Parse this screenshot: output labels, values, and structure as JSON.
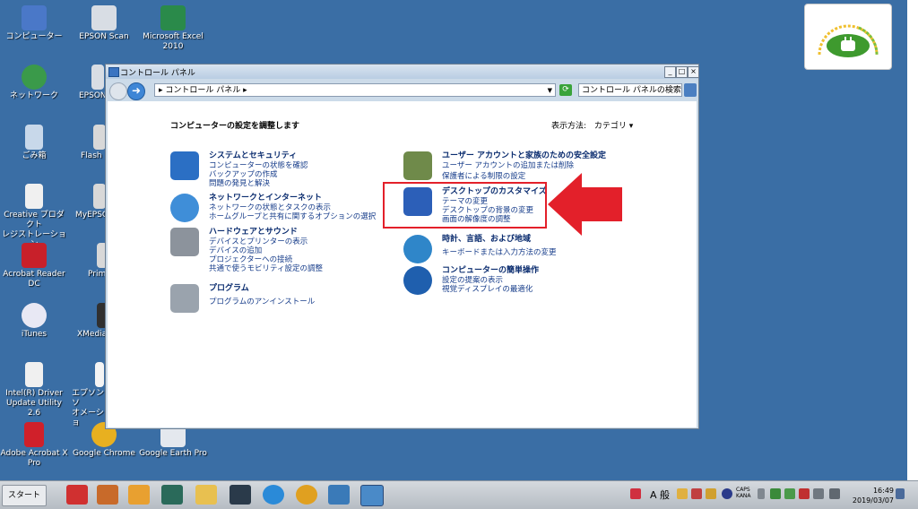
{
  "desktop_icons": [
    {
      "label": "コンピューター",
      "icon": "computer-icon",
      "color": "#4a78c8"
    },
    {
      "label": "ネットワーク",
      "icon": "network-icon",
      "color": "#3a9a4a"
    },
    {
      "label": "ごみ箱",
      "icon": "recycle-bin-icon",
      "color": "#c8d8ea"
    },
    {
      "label": "Creative プロダクト\nレジストレーション",
      "icon": "creative-icon",
      "color": "#f0f0f0"
    },
    {
      "label": "Acrobat Reader DC",
      "icon": "acrobat-reader-icon",
      "color": "#c8202a"
    },
    {
      "label": "iTunes",
      "icon": "itunes-icon",
      "color": "#e8e8f4"
    },
    {
      "label": "Intel(R) Driver\nUpdate Utility 2.6",
      "icon": "intel-icon",
      "color": "#f0f0f0"
    },
    {
      "label": "Adobe Acrobat X\nPro",
      "icon": "adobe-acrobat-icon",
      "color": "#d0202a"
    },
    {
      "label": "EPSON Scan",
      "icon": "epson-scan-icon",
      "color": "#d8dde4"
    },
    {
      "label": "EPSON",
      "icon": "epson-icon",
      "color": "#d8dde4"
    },
    {
      "label": "Flash",
      "icon": "flash-icon",
      "color": "#d8d8d8"
    },
    {
      "label": "MyEPSO",
      "icon": "myepson-icon",
      "color": "#d8d8d8"
    },
    {
      "label": "Prim",
      "icon": "prim-icon",
      "color": "#d8d8d8"
    },
    {
      "label": "XMedia",
      "icon": "xmedia-icon",
      "color": "#303030"
    },
    {
      "label": "エプソンソ\nオメーショ",
      "icon": "epson-info-icon",
      "color": "#f4f4f4"
    },
    {
      "label": "Google Chrome",
      "icon": "chrome-icon",
      "color": "#e8b020"
    },
    {
      "label": "Microsoft Excel\n2010",
      "icon": "excel-icon",
      "color": "#2a8a4a"
    },
    {
      "label": "Google Earth Pro",
      "icon": "google-earth-icon",
      "color": "#e4e8ee"
    }
  ],
  "window": {
    "title": "コントロール パネル",
    "address": "▸ コントロール パネル ▸",
    "search_placeholder": "コントロール パネルの検索",
    "heading": "コンピューターの設定を調整します",
    "view_by_label": "表示方法:",
    "view_by_value": "カテゴリ ▾"
  },
  "categories_left": [
    {
      "title": "システムとセキュリティ",
      "icon": "shield-icon",
      "color": "#2b6fc4",
      "links": [
        "コンピューターの状態を確認",
        "バックアップの作成",
        "問題の発見と解決"
      ]
    },
    {
      "title": "ネットワークとインターネット",
      "icon": "network-globe-icon",
      "color": "#3f8ed8",
      "links": [
        "ネットワークの状態とタスクの表示",
        "ホームグループと共有に関するオプションの選択"
      ]
    },
    {
      "title": "ハードウェアとサウンド",
      "icon": "printer-icon",
      "color": "#8c939c",
      "links": [
        "デバイスとプリンターの表示",
        "デバイスの追加",
        "プロジェクターへの接続",
        "共通で使うモビリティ設定の調整"
      ]
    },
    {
      "title": "プログラム",
      "icon": "programs-icon",
      "color": "#9aa3ad",
      "links": [
        "プログラムのアンインストール"
      ]
    }
  ],
  "categories_right": [
    {
      "title": "ユーザー アカウントと家族のための安全設定",
      "icon": "users-icon",
      "color": "#6f8a4a",
      "links": [
        "ユーザー アカウントの追加または削除",
        "保護者による制限の設定"
      ]
    },
    {
      "title": "デスクトップのカスタマイズ",
      "icon": "monitor-icon",
      "color": "#2c5fb8",
      "links": [
        "テーマの変更",
        "デスクトップの背景の変更",
        "画面の解像度の調整"
      ]
    },
    {
      "title": "時計、言語、および地域",
      "icon": "clock-globe-icon",
      "color": "#2f86c9",
      "links": [
        "キーボードまたは入力方法の変更"
      ]
    },
    {
      "title": "コンピューターの簡単操作",
      "icon": "ease-of-access-icon",
      "color": "#1f5fae",
      "links": [
        "設定の提案の表示",
        "視覚ディスプレイの最適化"
      ]
    }
  ],
  "taskbar": {
    "start_label": "スタート",
    "apps": [
      {
        "icon": "pin-icon",
        "color": "#d03030"
      },
      {
        "icon": "folder-tools-icon",
        "color": "#c86a2a"
      },
      {
        "icon": "media-player-icon",
        "color": "#e8a030"
      },
      {
        "icon": "video-editor-icon",
        "color": "#2a6a5a"
      },
      {
        "icon": "explorer-folder-icon",
        "color": "#e8c050"
      },
      {
        "icon": "film-icon",
        "color": "#2a3a4a"
      },
      {
        "icon": "internet-explorer-icon",
        "color": "#2a8ad8"
      },
      {
        "icon": "chrome-icon",
        "color": "#e0a020"
      },
      {
        "icon": "photo-viewer-icon",
        "color": "#3a7ab8"
      },
      {
        "icon": "control-panel-icon",
        "color": "#4a8ac8"
      }
    ],
    "ime_label": "A 般",
    "caps": "CAPS\nKANA",
    "clock_time": "16:49",
    "clock_date": "2019/03/07"
  },
  "accent": {
    "highlight": "#e3202a",
    "arrow": "#e3202a"
  }
}
